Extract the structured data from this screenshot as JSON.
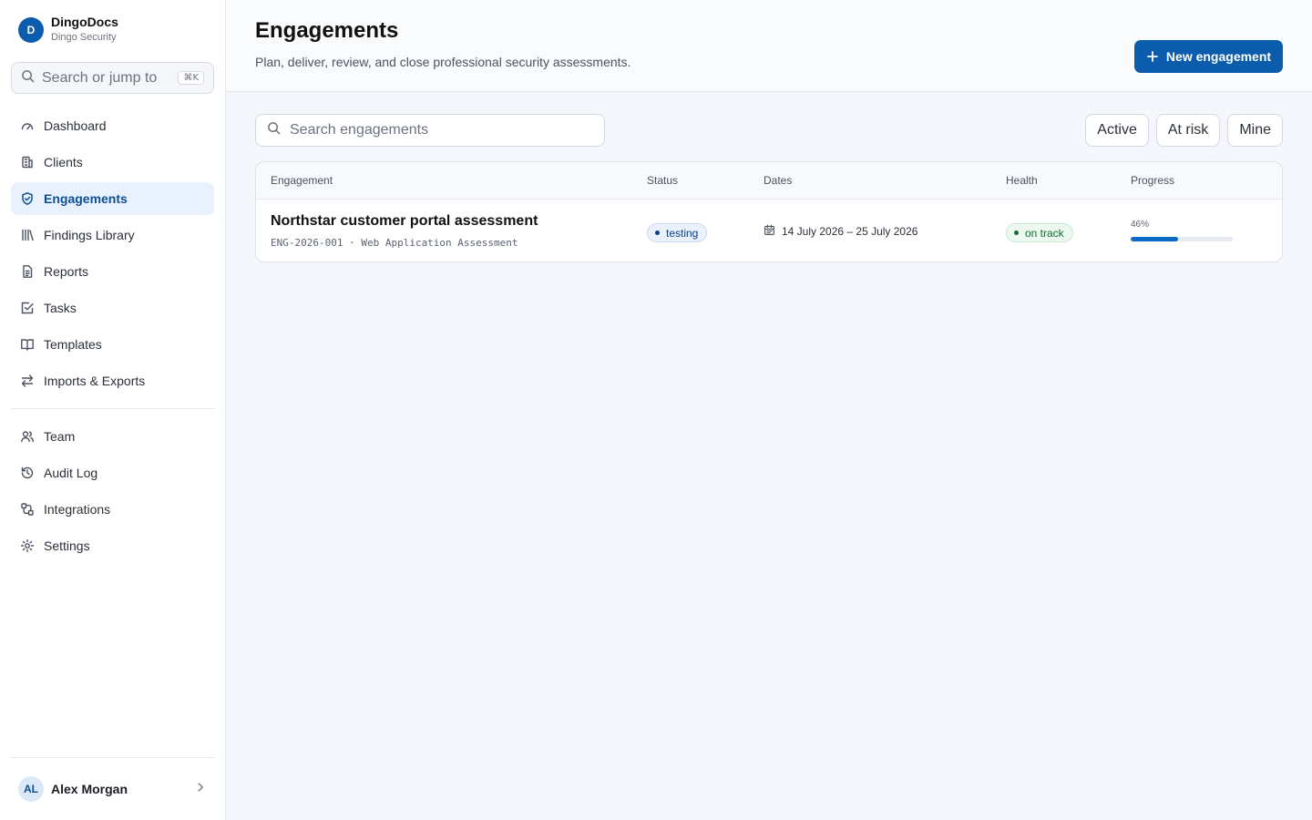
{
  "brand": {
    "initial": "D",
    "name": "DingoDocs",
    "org": "Dingo Security"
  },
  "sidebar": {
    "search": {
      "placeholder": "Search or jump to",
      "shortcut": "⌘K"
    },
    "items": [
      {
        "label": "Dashboard",
        "icon": "gauge-icon",
        "active": false
      },
      {
        "label": "Clients",
        "icon": "building-icon",
        "active": false
      },
      {
        "label": "Engagements",
        "icon": "shield-icon",
        "active": true
      },
      {
        "label": "Findings Library",
        "icon": "library-icon",
        "active": false
      },
      {
        "label": "Reports",
        "icon": "file-text-icon",
        "active": false
      },
      {
        "label": "Tasks",
        "icon": "check-square-icon",
        "active": false
      },
      {
        "label": "Templates",
        "icon": "book-open-icon",
        "active": false
      },
      {
        "label": "Imports & Exports",
        "icon": "arrows-swap-icon",
        "active": false
      }
    ],
    "secondary_items": [
      {
        "label": "Team",
        "icon": "users-icon"
      },
      {
        "label": "Audit Log",
        "icon": "history-icon"
      },
      {
        "label": "Integrations",
        "icon": "plug-icon"
      },
      {
        "label": "Settings",
        "icon": "gear-icon"
      }
    ],
    "user": {
      "initials": "AL",
      "name": "Alex Morgan"
    }
  },
  "header": {
    "title": "Engagements",
    "subtitle": "Plan, deliver, review, and close professional security assessments.",
    "new_button": "New engagement"
  },
  "toolbar": {
    "search_placeholder": "Search engagements",
    "filters": [
      "Active",
      "At risk",
      "Mine"
    ]
  },
  "table": {
    "columns": [
      "Engagement",
      "Status",
      "Dates",
      "Health",
      "Progress"
    ],
    "rows": [
      {
        "title": "Northstar customer portal assessment",
        "meta": "ENG-2026-001 · Web Application Assessment",
        "status": "testing",
        "dates": "14 July 2026 – 25 July 2026",
        "health": "on track",
        "progress_label": "46%",
        "progress": 0.46
      }
    ]
  },
  "colors": {
    "accent": "#0b5cad",
    "active_bg": "#e9f2fc"
  }
}
